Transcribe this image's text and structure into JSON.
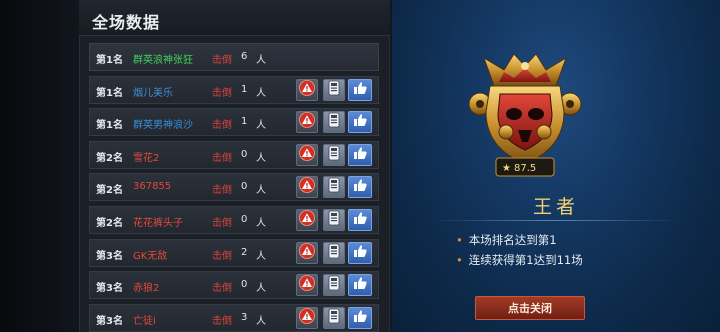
{
  "panel": {
    "title": "全场数据"
  },
  "kills_label": "击倒",
  "kills_unit": "人",
  "rows": [
    {
      "rank": "第1名",
      "name": "群英浪神张狂",
      "name_color": "#3fd25a",
      "kills": "6",
      "show_actions": false
    },
    {
      "rank": "第1名",
      "name": "烟儿美乐",
      "name_color": "#3a8fd8",
      "kills": "1",
      "show_actions": true
    },
    {
      "rank": "第1名",
      "name": "群英男神浪沙",
      "name_color": "#3a8fd8",
      "kills": "1",
      "show_actions": true
    },
    {
      "rank": "第2名",
      "name": "雪花2",
      "name_color": "#e14a3c",
      "kills": "0",
      "show_actions": true
    },
    {
      "rank": "第2名",
      "name": "367855",
      "name_color": "#e14a3c",
      "kills": "0",
      "show_actions": true
    },
    {
      "rank": "第2名",
      "name": "花花裤头子",
      "name_color": "#e14a3c",
      "kills": "0",
      "show_actions": true
    },
    {
      "rank": "第3名",
      "name": "GK无敌",
      "name_color": "#e14a3c",
      "kills": "2",
      "show_actions": true
    },
    {
      "rank": "第3名",
      "name": "赤狼2",
      "name_color": "#e14a3c",
      "kills": "0",
      "show_actions": true
    },
    {
      "rank": "第3名",
      "name": "亡徒i",
      "name_color": "#e14a3c",
      "kills": "3",
      "show_actions": true
    }
  ],
  "result": {
    "rank_title": "王者",
    "score": "87.5",
    "achievements": [
      "本场排名达到第1",
      "连续获得第1达到11场"
    ],
    "close_button": "点击关闭"
  },
  "icons": {
    "report": "warning-icon",
    "info": "info-card-icon",
    "like": "thumbs-up-icon"
  },
  "colors": {
    "kill_label": "#d9443b",
    "rank_title": "#f0cf72",
    "bullet": "#e58a2b",
    "like_button": "#3d6fc2"
  }
}
